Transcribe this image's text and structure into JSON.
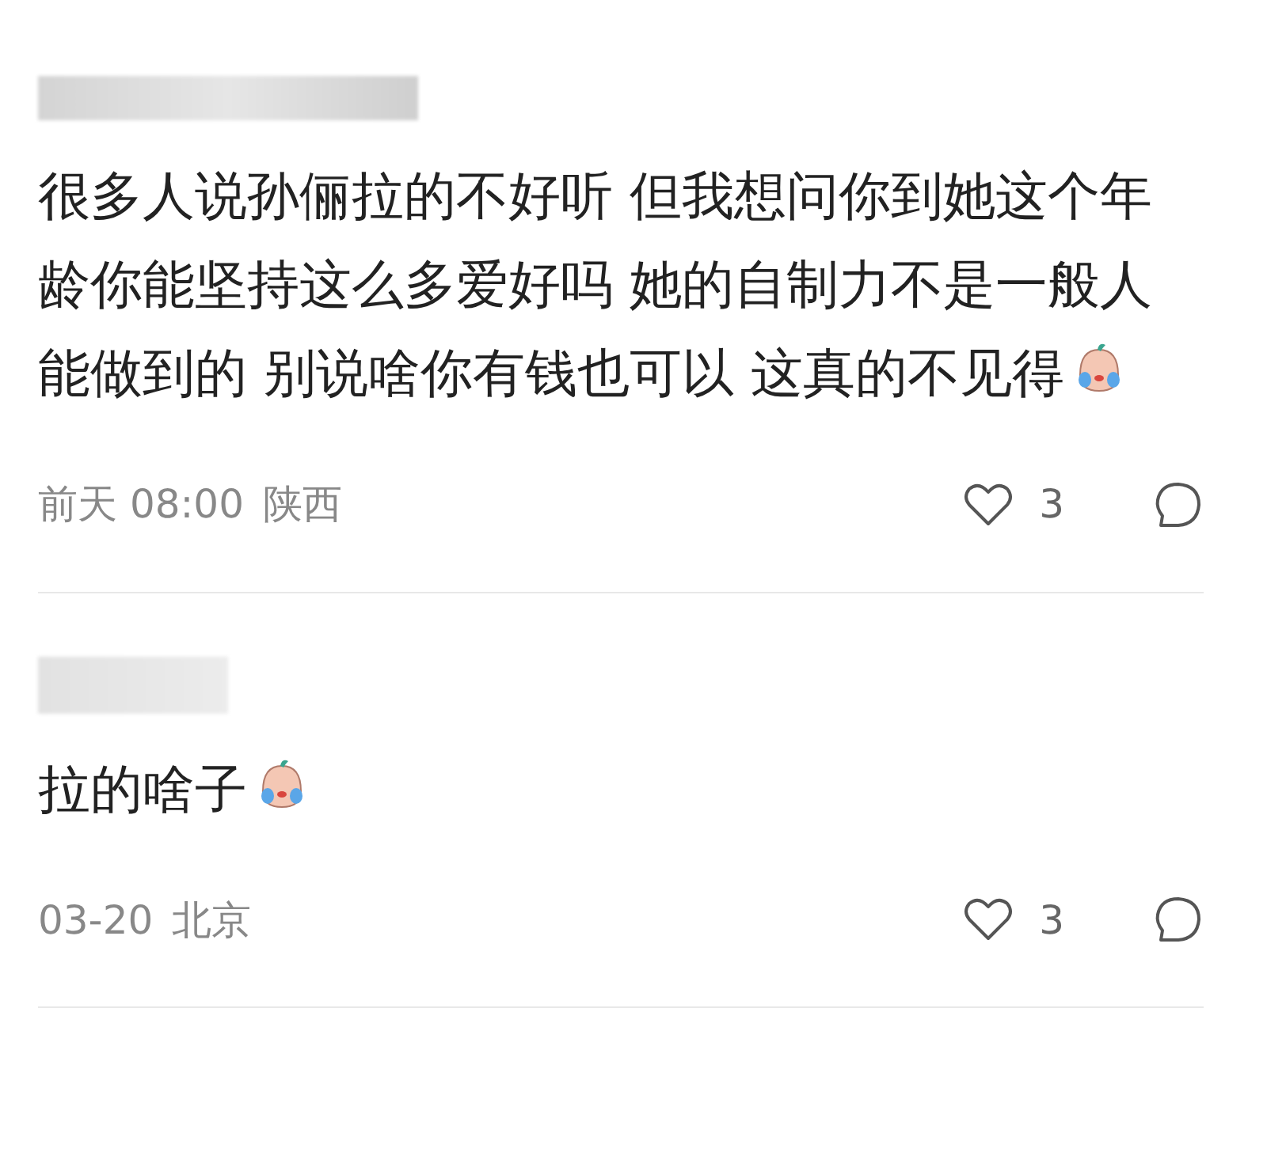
{
  "comments": [
    {
      "text": "很多人说孙俪拉的不好听 但我想问你到她这个年龄你能坚持这么多爱好吗 她的自制力不是一般人能做到的 别说啥你有钱也可以 这真的不见得",
      "sticker": true,
      "time": "前天 08:00",
      "location": "陕西",
      "likes": "3"
    },
    {
      "text": "拉的啥子",
      "sticker": true,
      "time": "03-20",
      "location": "北京",
      "likes": "3"
    }
  ]
}
